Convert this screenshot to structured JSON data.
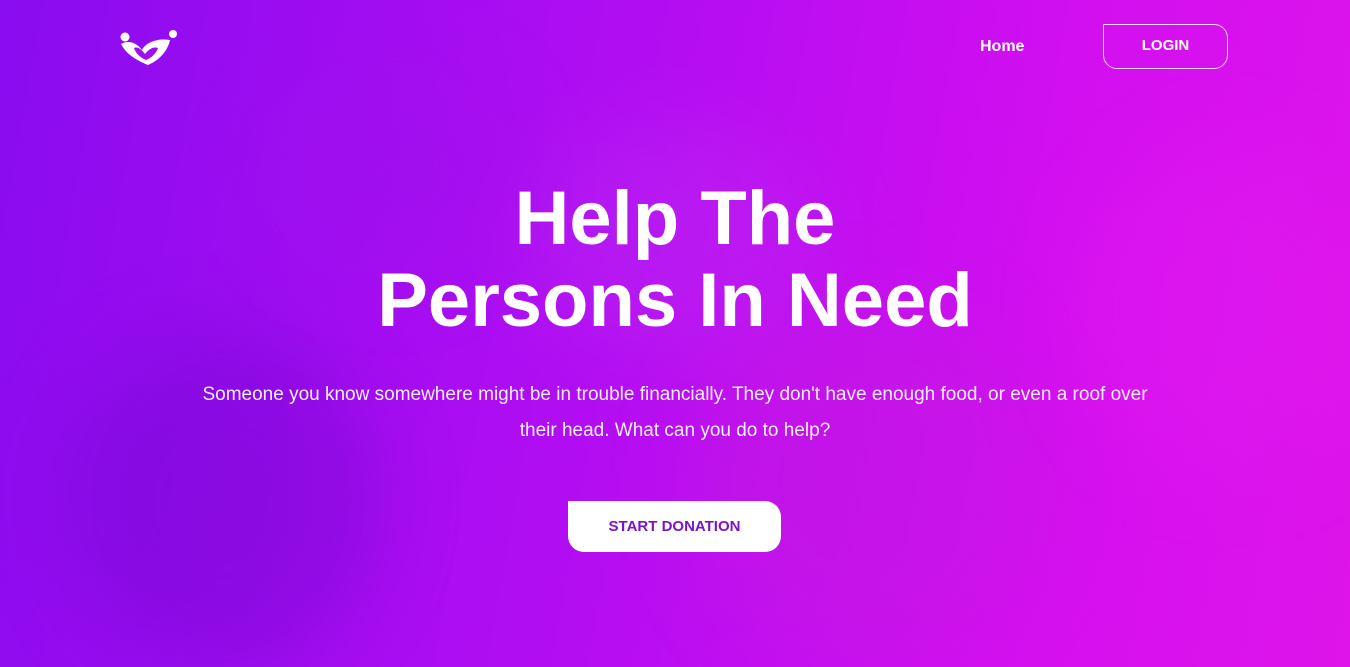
{
  "nav": {
    "home_label": "Home",
    "login_label": "LOGIN"
  },
  "logo": {
    "icon": "charity-heart-logo-icon"
  },
  "hero": {
    "headline_line1": "Help The",
    "headline_line2": "Persons In Need",
    "subtitle": "Someone you know somewhere might be in trouble financially. They don't have enough food, or even a roof over their head. What can you do to help?",
    "cta_label": "START DONATION"
  },
  "colors": {
    "gradient_start": "#8a0cf0",
    "gradient_end": "#de14ea",
    "cta_text": "#7b14c8",
    "cta_bg": "#ffffff"
  }
}
